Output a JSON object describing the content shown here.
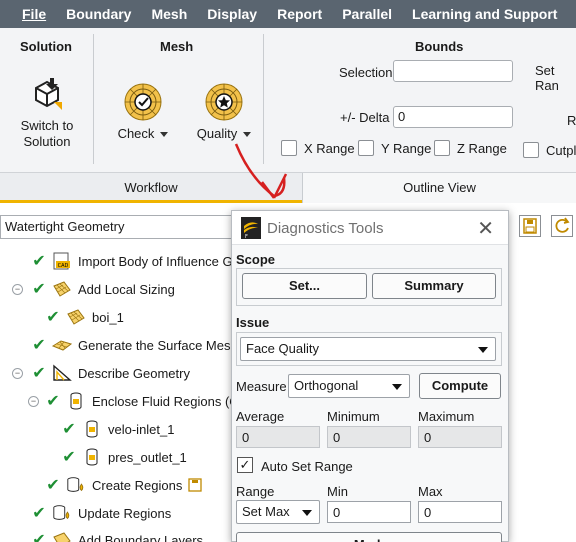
{
  "menu": [
    "File",
    "Boundary",
    "Mesh",
    "Display",
    "Report",
    "Parallel",
    "Learning and Support"
  ],
  "ribbon": {
    "solution_title": "Solution",
    "switch_line1": "Switch to",
    "switch_line2": "Solution",
    "mesh_title": "Mesh",
    "check_label": "Check",
    "quality_label": "Quality",
    "bounds_title": "Bounds",
    "selection_label": "Selection",
    "selection_value": "",
    "delta_label": "+/- Delta",
    "delta_value": "0",
    "set_range_label": "Set Ran",
    "r_label": "R",
    "x_range": "X Range",
    "y_range": "Y Range",
    "z_range": "Z Range",
    "cutpl": "Cutpl"
  },
  "tabs": [
    "Workflow",
    "Outline View"
  ],
  "workflow": {
    "type": "Watertight Geometry",
    "steps": [
      "Import Body of Influence G",
      "Add Local Sizing",
      "boi_1",
      "Generate the Surface Mes",
      "Describe Geometry",
      "Enclose Fluid Regions (C",
      "velo-inlet_1",
      "pres_outlet_1",
      "Create Regions",
      "Update Regions",
      "Add Boundary Layers"
    ]
  },
  "dialog": {
    "title": "Diagnostics Tools",
    "scope_title": "Scope",
    "set_btn": "Set...",
    "summary_btn": "Summary",
    "issue_title": "Issue",
    "issue_value": "Face Quality",
    "measure_label": "Measure",
    "measure_value": "Orthogonal",
    "compute_btn": "Compute",
    "average_label": "Average",
    "minimum_label": "Minimum",
    "maximum_label": "Maximum",
    "average_value": "0",
    "minimum_value": "0",
    "maximum_value": "0",
    "auto_set_range": "Auto Set Range",
    "range_label": "Range",
    "min_label": "Min",
    "max_label": "Max",
    "range_value": "Set Max",
    "min_value": "0",
    "max_value": "0",
    "bottom_btn": "Mark"
  },
  "colors": {
    "accent": "#f0b400",
    "check": "#1e8f34",
    "arrow": "#d62020",
    "menubar": "#5a6570"
  }
}
